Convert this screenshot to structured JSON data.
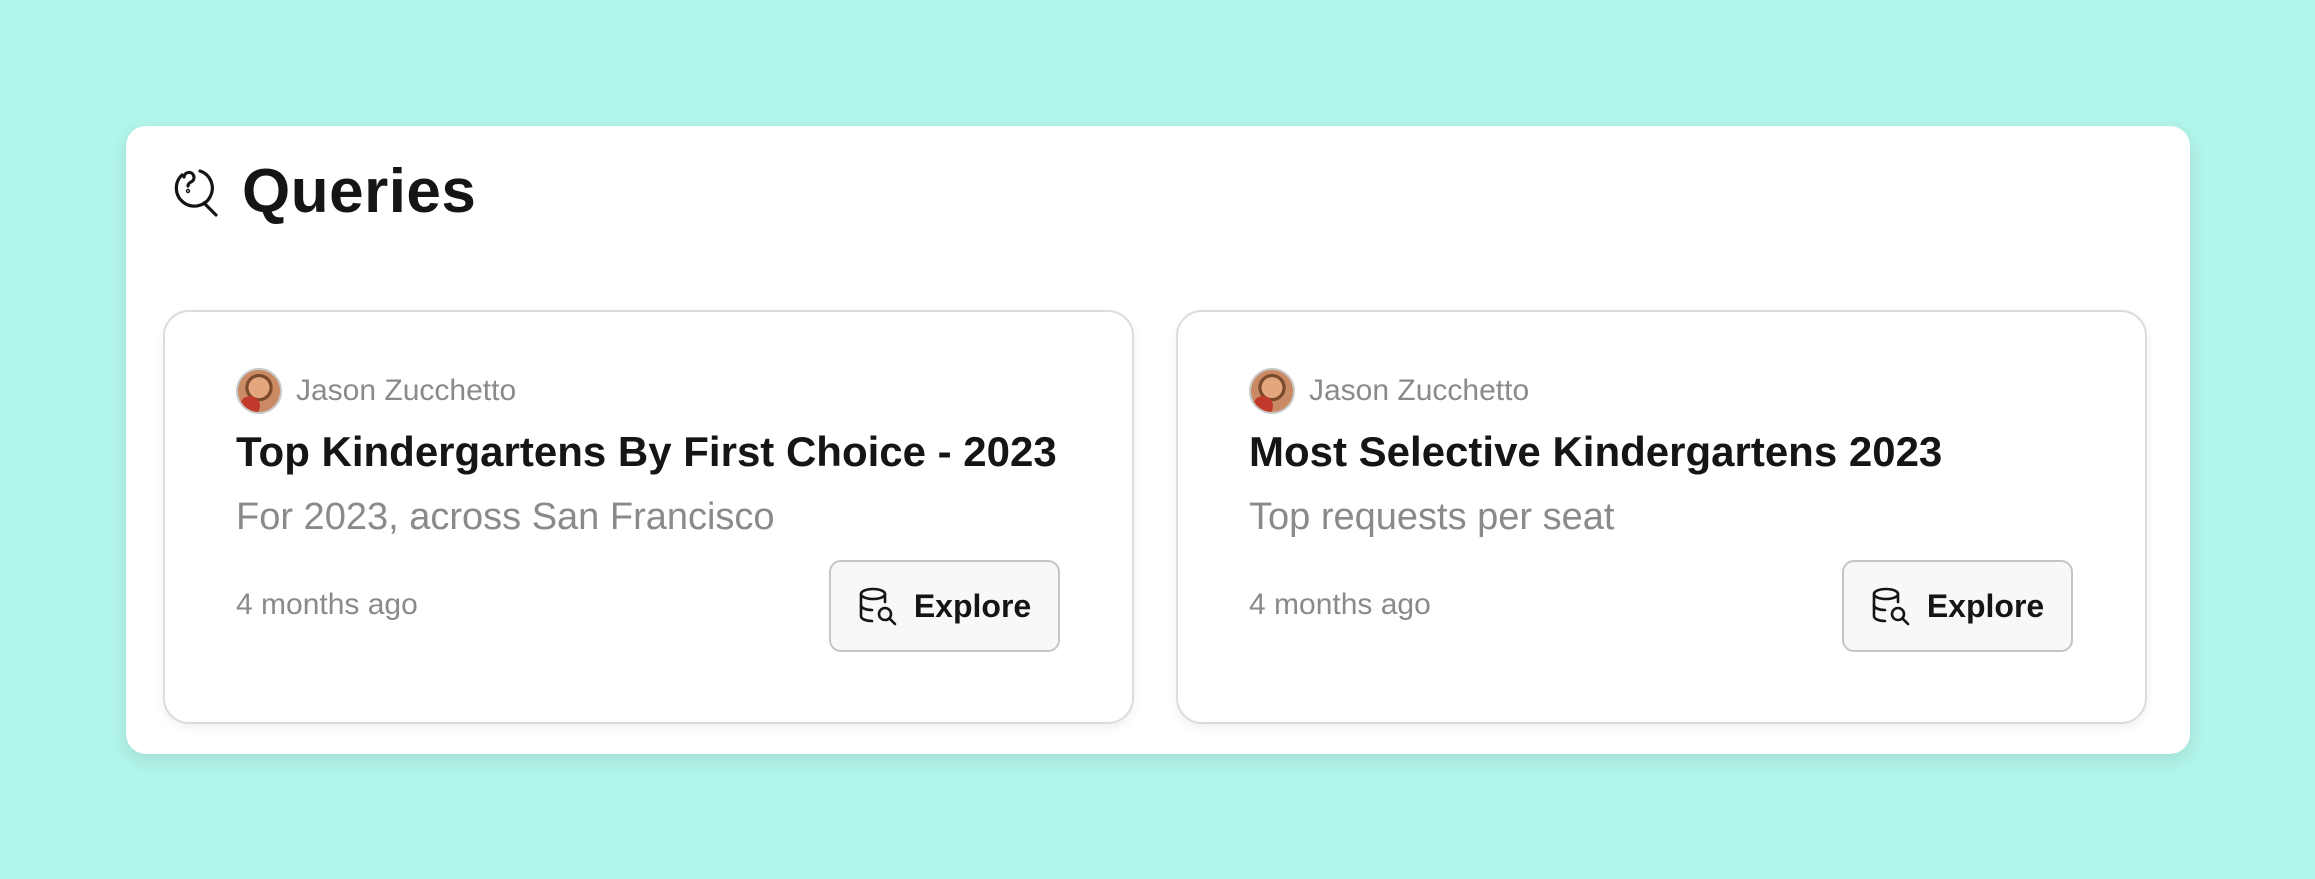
{
  "panel": {
    "title": "Queries",
    "icon": "search-question-icon"
  },
  "cards": [
    {
      "author": "Jason Zucchetto",
      "title": "Top Kindergartens By First Choice - 2023",
      "subtitle": "For 2023, across San Francisco",
      "time": "4 months ago",
      "button_label": "Explore",
      "button_icon": "database-search-icon"
    },
    {
      "author": "Jason Zucchetto",
      "title": "Most Selective Kindergartens 2023",
      "subtitle": "Top requests per seat",
      "time": "4 months ago",
      "button_label": "Explore",
      "button_icon": "database-search-icon"
    }
  ],
  "colors": {
    "background": "#b2f5ea",
    "panel": "#ffffff",
    "title_text": "#151515",
    "muted_text": "#8a8a8a",
    "button_bg": "#f6f8fa"
  }
}
